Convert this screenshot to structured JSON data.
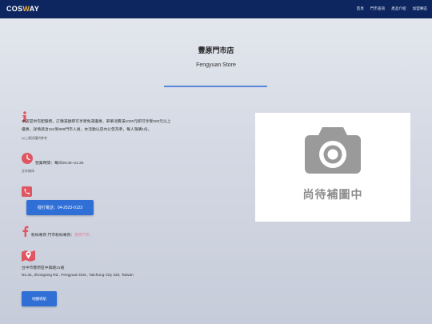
{
  "header": {
    "logo_prefix": "COS",
    "logo_accent": "W",
    "logo_suffix": "AY",
    "nav": [
      "首頁",
      "門市查詢",
      "產品介紹",
      "加盟專區"
    ]
  },
  "store": {
    "title_zh": "豐原門市店",
    "title_en": "Fengyuan Store"
  },
  "info": {
    "line1": "本店提供宅配服務，訂購滿額即可享受免運優惠，單筆消費滿1000元即可享受900元以上",
    "line2": "優惠，詳情請洽152到989門市人員，本活動以店內公告為準，每人限購1份，",
    "line3": "以上資訊僅供參考"
  },
  "hours": {
    "text": "營業時間：每日09:30~21:30",
    "note": "全年無休"
  },
  "phone": {
    "button_label": "撥打電話：04-2523-0123"
  },
  "facebook": {
    "label": "粉絲專頁 門市粉絲專頁：",
    "link": "豐原門市"
  },
  "address": {
    "zh": "台中市豐原區中興路31號",
    "en": "No.31, Zhongxing Rd., Fengyuan Dist., Taichung City 420, Taiwan",
    "map_button": "地圖導航"
  },
  "photo": {
    "placeholder": "尚待補圖中"
  },
  "colors": {
    "header_bg": "#0e2660",
    "accent_button": "#2f6fd6",
    "icon_red": "#e05562"
  }
}
